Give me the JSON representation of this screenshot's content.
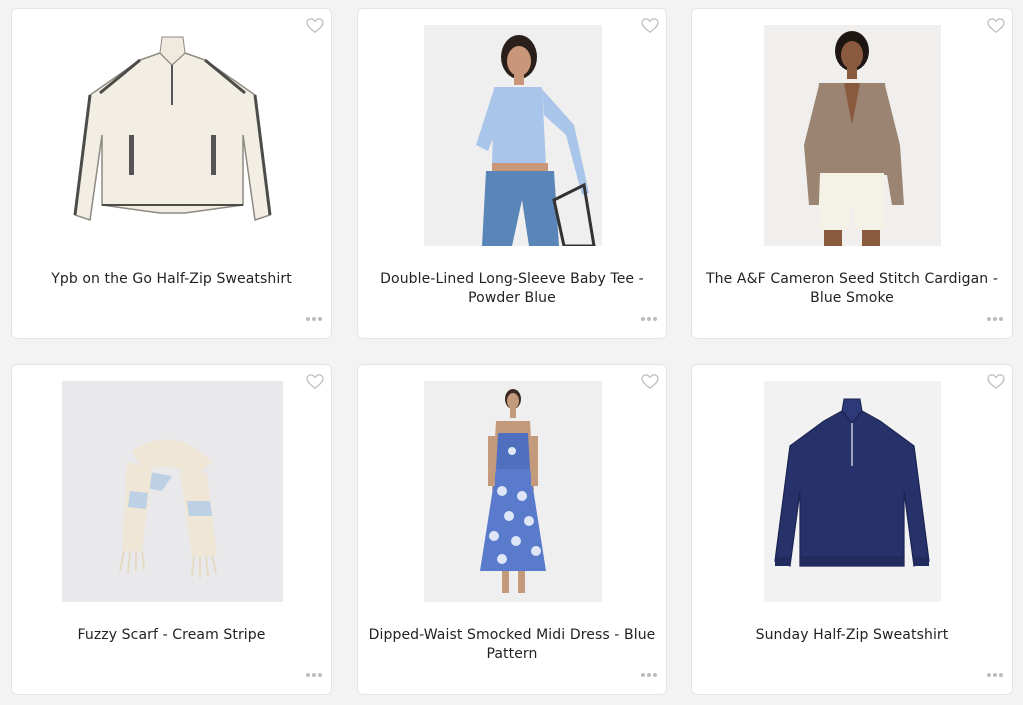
{
  "products": [
    {
      "title": "Ypb on the Go Half-Zip Sweatshirt",
      "image": "cream-sherpa-half-zip-sweatshirt"
    },
    {
      "title": "Double-Lined Long-Sleeve Baby Tee - Powder Blue",
      "image": "model-in-powder-blue-tee"
    },
    {
      "title": "The A&F Cameron Seed Stitch Cardigan - Blue Smoke",
      "image": "model-in-taupe-cardigan"
    },
    {
      "title": "Fuzzy Scarf - Cream Stripe",
      "image": "cream-striped-scarf"
    },
    {
      "title": "Dipped-Waist Smocked Midi Dress - Blue Pattern",
      "image": "model-in-blue-pattern-midi-dress"
    },
    {
      "title": "Sunday Half-Zip Sweatshirt",
      "image": "navy-half-zip-sweatshirt"
    }
  ],
  "icons": {
    "favorite": "heart-outline-icon",
    "more": "more-dots-icon"
  },
  "colors": {
    "page_bg": "#f3f3f3",
    "card_bg": "#ffffff",
    "card_border": "#e4e4e4",
    "icon": "#bdbdbd"
  }
}
